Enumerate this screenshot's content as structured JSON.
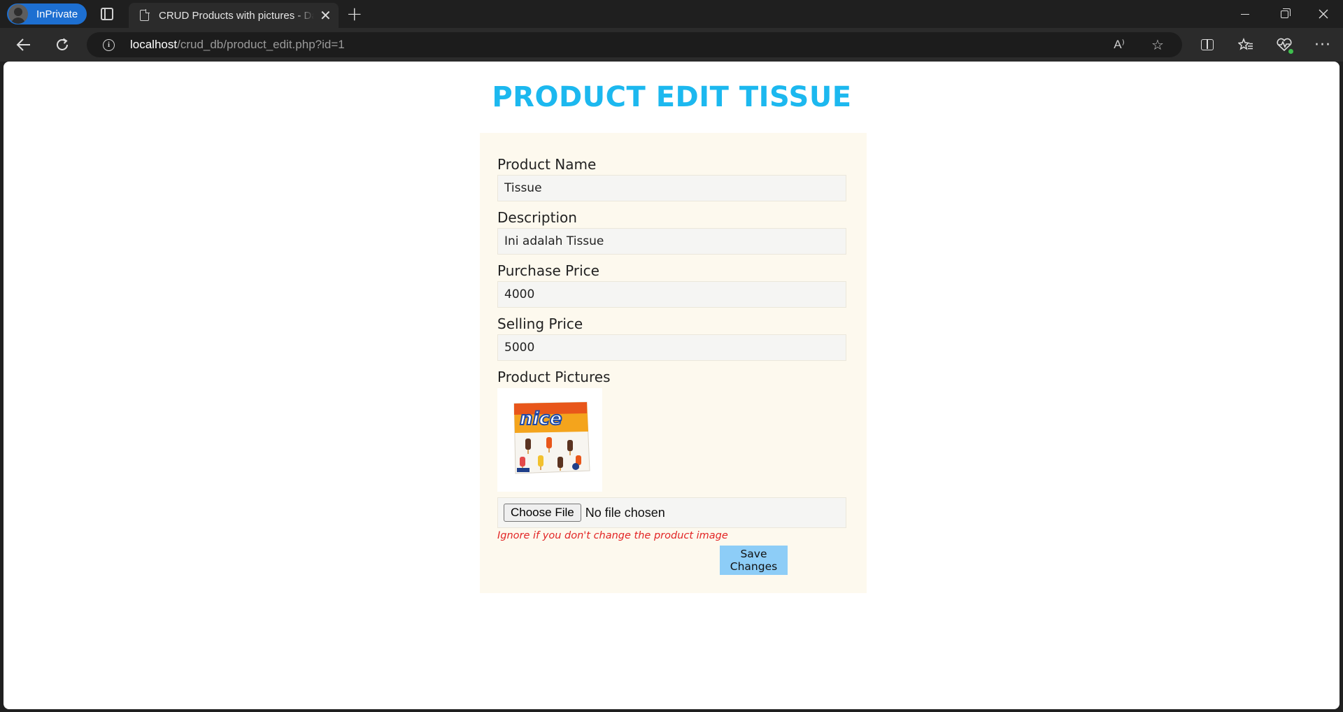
{
  "browser": {
    "profile_label": "InPrivate",
    "tab_title": "CRUD Products with pictures - Da",
    "tab_close": "✕",
    "new_tab": "+",
    "url_host": "localhost",
    "url_path": "/crud_db/product_edit.php?id=1",
    "read_aloud": "A⁾",
    "favorite": "☆",
    "favorites": "☆≡",
    "more": "···"
  },
  "page": {
    "title": "PRODUCT EDIT TISSUE"
  },
  "form": {
    "product_name_label": "Product Name",
    "product_name_value": "Tissue",
    "description_label": "Description",
    "description_value": "Ini adalah Tissue",
    "purchase_price_label": "Purchase Price",
    "purchase_price_value": "4000",
    "selling_price_label": "Selling Price",
    "selling_price_value": "5000",
    "pictures_label": "Product Pictures",
    "choose_file_label": "Choose File",
    "no_file_text": "No file chosen",
    "hint": "Ignore if you don't change the product image",
    "save_label": "Save Changes"
  },
  "product_image": {
    "brand_text": "nice"
  },
  "colors": {
    "title": "#1cb8ef",
    "card_background": "#fdf9ee",
    "save_button": "#8dcdf7",
    "hint": "#e22424"
  }
}
